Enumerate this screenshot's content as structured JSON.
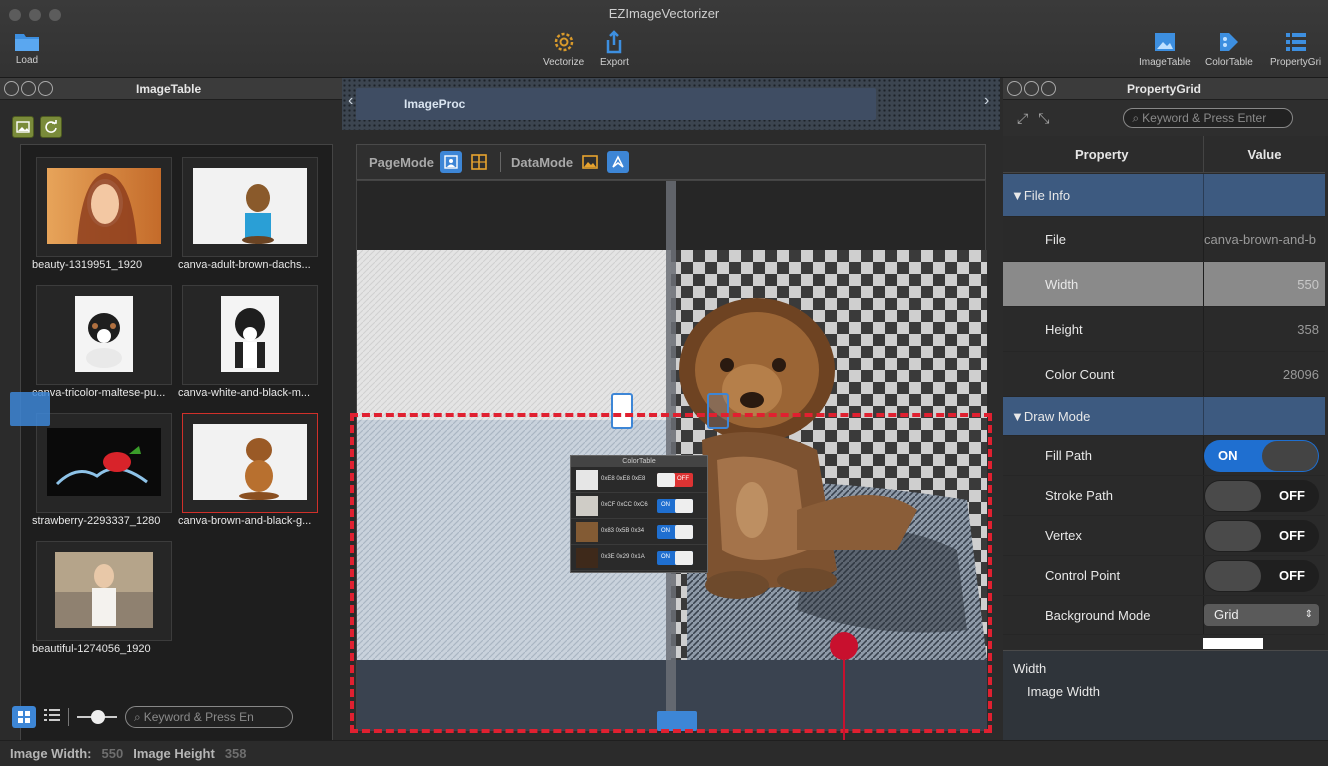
{
  "window": {
    "title": "EZImageVectorizer"
  },
  "toolbar": {
    "load": "Load",
    "vectorize": "Vectorize",
    "export": "Export",
    "image_table": "ImageTable",
    "color_table": "ColorTable",
    "property_grid": "PropertyGri"
  },
  "image_table": {
    "title": "ImageTable",
    "items": [
      {
        "name": "beauty-1319951_1920",
        "selected": false
      },
      {
        "name": "canva-adult-brown-dachs...",
        "selected": false
      },
      {
        "name": "canva-tricolor-maltese-pu...",
        "selected": false
      },
      {
        "name": "canva-white-and-black-m...",
        "selected": false
      },
      {
        "name": "strawberry-2293337_1280",
        "selected": false
      },
      {
        "name": "canva-brown-and-black-g...",
        "selected": true
      },
      {
        "name": "beautiful-1274056_1920",
        "selected": false
      }
    ],
    "search_placeholder": "Keyword & Press En"
  },
  "center": {
    "tab": "ImageProc",
    "page_mode": "PageMode",
    "data_mode": "DataMode",
    "mini_color_table": {
      "title": "ColorTable",
      "rows": [
        {
          "hex": "0xE8 0xE8 0xE8",
          "state": "OFF",
          "swatch": "#e6e6e6"
        },
        {
          "hex": "0xCF 0xCC 0xC6",
          "state": "ON",
          "swatch": "#cfccc6"
        },
        {
          "hex": "0x83 0x5B 0x34",
          "state": "ON",
          "swatch": "#835b34"
        },
        {
          "hex": "0x3E 0x29 0x1A",
          "state": "ON",
          "swatch": "#3e291a"
        }
      ]
    }
  },
  "property_grid": {
    "title": "PropertyGrid",
    "search_placeholder": "Keyword & Press Enter",
    "col_property": "Property",
    "col_value": "Value",
    "rows": [
      {
        "type": "cat",
        "key": "▼File Info"
      },
      {
        "type": "text",
        "key": "File",
        "value": "canva-brown-and-b"
      },
      {
        "type": "text",
        "key": "Width",
        "value": "550",
        "selected": true
      },
      {
        "type": "text",
        "key": "Height",
        "value": "358"
      },
      {
        "type": "text",
        "key": "Color Count",
        "value": "28096"
      },
      {
        "type": "cat",
        "key": "▼Draw Mode"
      },
      {
        "type": "toggle",
        "key": "Fill Path",
        "value": "ON"
      },
      {
        "type": "toggle",
        "key": "Stroke Path",
        "value": "OFF"
      },
      {
        "type": "toggle",
        "key": "Vertex",
        "value": "OFF"
      },
      {
        "type": "toggle",
        "key": "Control Point",
        "value": "OFF"
      },
      {
        "type": "select",
        "key": "Background Mode",
        "value": "Grid"
      }
    ],
    "desc_title": "Width",
    "desc_body": "Image Width"
  },
  "status": {
    "width_label": "Image Width:",
    "width_value": "550",
    "height_label": "Image Height",
    "height_value": "358"
  },
  "colors": {
    "accent": "#3d86d6",
    "selection": "#d0302a",
    "category": "#3d5a80",
    "marker": "#c8102e"
  }
}
